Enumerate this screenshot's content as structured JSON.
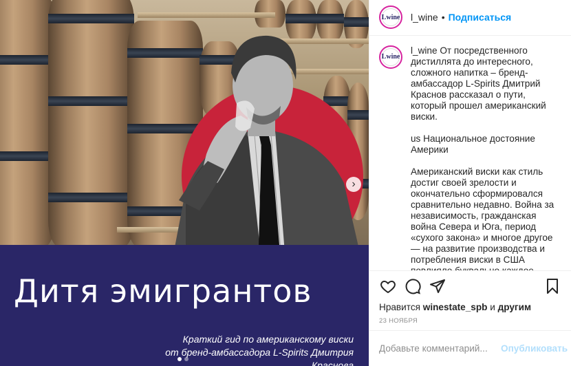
{
  "account": {
    "username": "l_wine",
    "avatar_text": "Lwine",
    "separator": "•",
    "follow_label": "Подписаться"
  },
  "post": {
    "headline": "Дитя эмигрантов",
    "subtitle_line1": "Краткий гид по американскому виски",
    "subtitle_line2": "от бренд-амбассадора L-Spirits Дмитрия Краснова",
    "slide_count": 2,
    "active_slide": 1
  },
  "caption": {
    "username": "l_wine",
    "paragraph1": "От посредственного дистиллята до интересного, сложного напитка – бренд-амбассадор L-Spirits Дмитрий Краснов рассказал о пути, который прошел американский виски.",
    "paragraph2": "us Национальное достояние Америки",
    "paragraph3": "Американский виски как стиль достиг своей зрелости и окончательно сформировался сравнительно недавно. Война за независимость, гражданская война Севера и Юга, период «сухого закона» и многое другое — на развитие производства и потребления виски в США повлияло буквально каждое значимое"
  },
  "actions": {
    "like_icon": "heart-icon",
    "comment_icon": "comment-icon",
    "share_icon": "share-icon",
    "save_icon": "bookmark-icon"
  },
  "likes": {
    "prefix": "Нравится",
    "user": "winestate_spb",
    "middle": "и",
    "suffix": "другим"
  },
  "date": "23 НОЯБРЯ",
  "comment_box": {
    "placeholder": "Добавьте комментарий...",
    "post_label": "Опубликовать"
  },
  "colors": {
    "navy": "#2a2667",
    "red": "#c8233a",
    "link": "#0095f6"
  }
}
